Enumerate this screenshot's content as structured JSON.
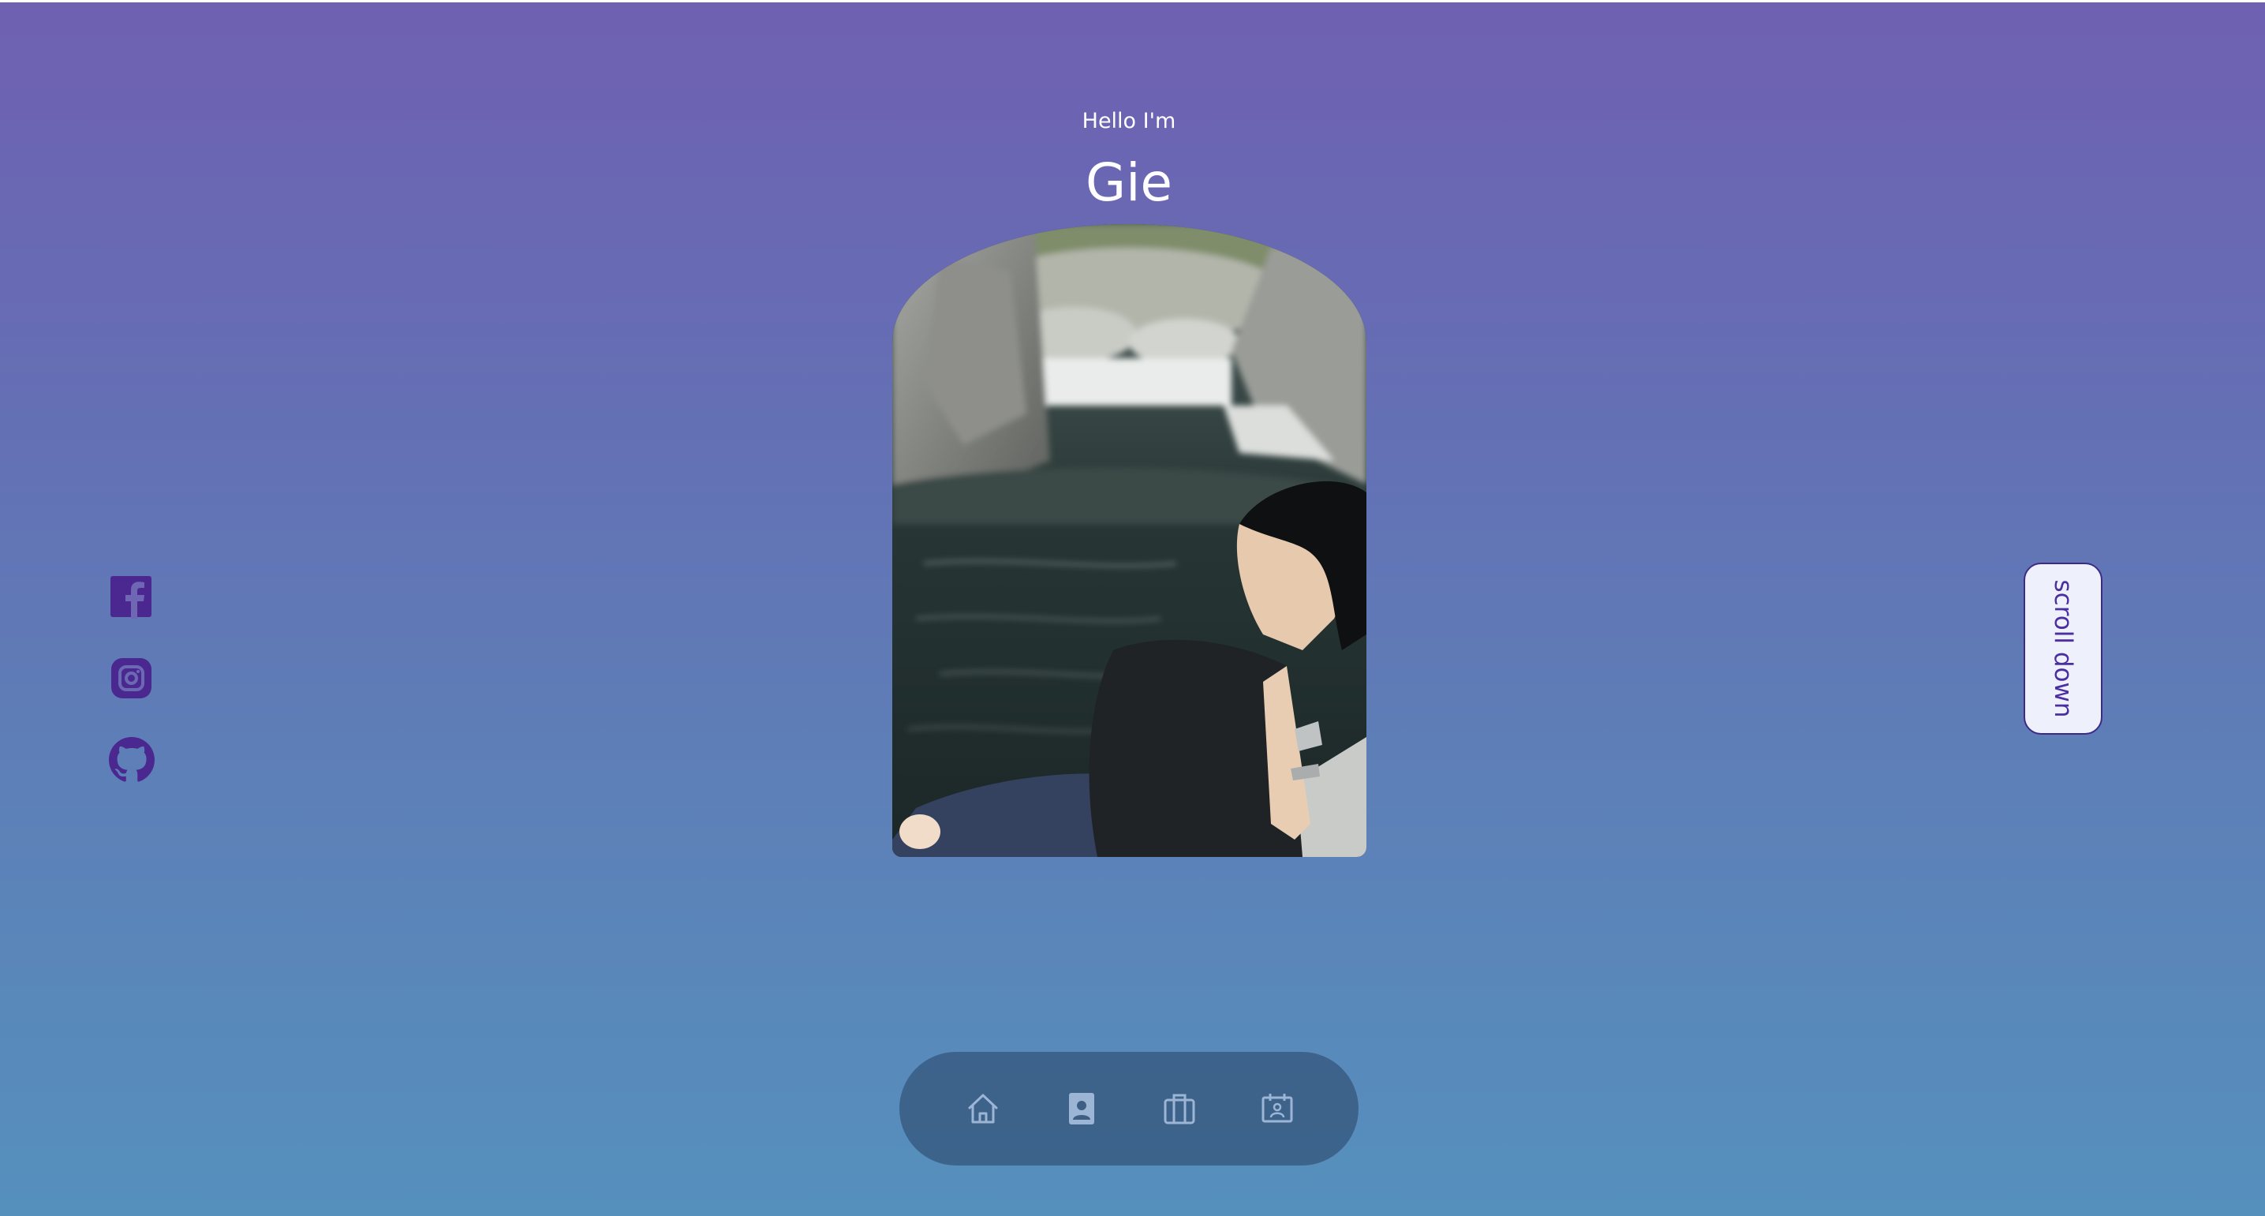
{
  "hero": {
    "greeting": "Hello I'm",
    "name": "Gie",
    "photo_alt": "Gie sitting on a rock beside a river"
  },
  "social_links": [
    {
      "icon": "facebook-icon"
    },
    {
      "icon": "instagram-icon"
    },
    {
      "icon": "github-icon"
    }
  ],
  "scroll_button": {
    "label": "scroll down"
  },
  "nav": {
    "items": [
      {
        "icon": "home-icon"
      },
      {
        "icon": "contact-card-icon"
      },
      {
        "icon": "briefcase-icon"
      },
      {
        "icon": "calendar-icon"
      }
    ]
  },
  "colors": {
    "gradient_top": "#6f60b2",
    "gradient_bottom": "#5590bd",
    "social_icon": "#4b2790",
    "scroll_text": "#4b2fa0",
    "nav_bg": "rgba(45, 75, 110, 0.62)"
  }
}
